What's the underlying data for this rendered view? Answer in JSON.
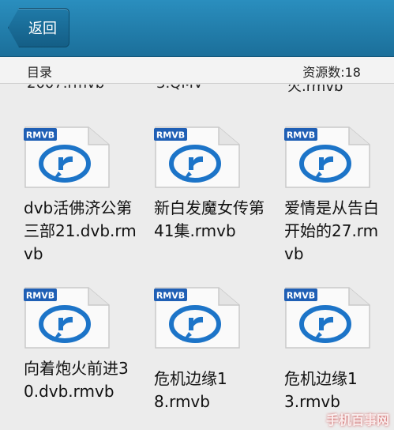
{
  "header": {
    "back_label": "返回"
  },
  "directory": {
    "label": "目录",
    "count_label": "资源数:18"
  },
  "cut_off_row": [
    "2007.rmvb",
    "3.QMV",
    "火.rmvb"
  ],
  "file_badge": "RMVB",
  "files": [
    {
      "name": "dvb活佛济公第三部21.dvb.rmvb"
    },
    {
      "name": "新白发魔女传第41集.rmvb"
    },
    {
      "name": "爱情是从告白开始的27.rmvb"
    },
    {
      "name": "向着炮火前进30.dvb.rmvb"
    },
    {
      "name": "危机边缘18.rmvb"
    },
    {
      "name": "危机边缘13.rmvb"
    }
  ],
  "watermark": "手机百事网",
  "colors": {
    "header": "#1b6f9a",
    "badge": "#1f5fb5",
    "logo": "#1c74c8"
  }
}
